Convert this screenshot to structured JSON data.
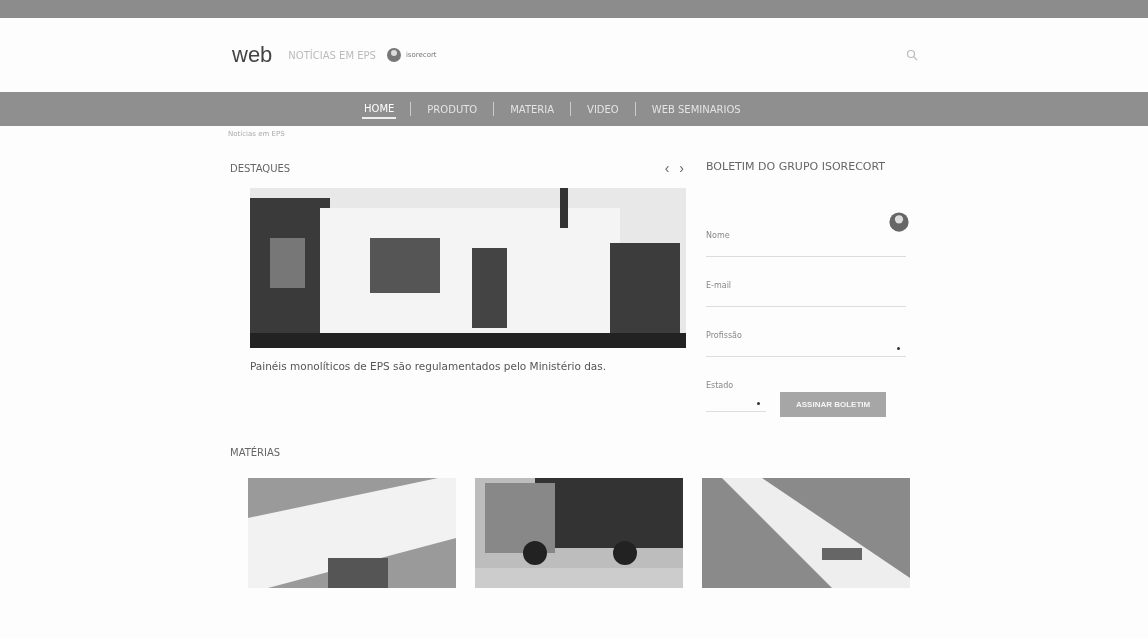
{
  "header": {
    "logo": "web",
    "tagline": "NOTÍCIAS EM EPS",
    "partner": "isorecort"
  },
  "nav": [
    {
      "label": "HOME",
      "selected": true
    },
    {
      "label": "PRODUTO",
      "selected": false
    },
    {
      "label": "MATERIA",
      "selected": false
    },
    {
      "label": "VIDEO",
      "selected": false
    },
    {
      "label": "WEB SEMINARIOS",
      "selected": false
    }
  ],
  "breadcrumb": "Notícias em EPS",
  "highlights": {
    "title": "DESTAQUES",
    "prev": "‹",
    "next": "›",
    "headline": "Painéis monolíticos de EPS são regulamentados pelo Ministério das."
  },
  "newsletter": {
    "title": "BOLETIM DO GRUPO ISORECORT",
    "fields": [
      {
        "label": "Nome",
        "kind": "text"
      },
      {
        "label": "E-mail",
        "kind": "text"
      },
      {
        "label": "Profissão",
        "kind": "select"
      }
    ],
    "state_label": "Estado",
    "button": "ASSINAR BOLETIM"
  },
  "articles": {
    "title": "MATÉRIAS"
  }
}
